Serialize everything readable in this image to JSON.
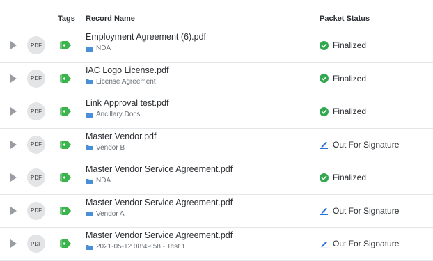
{
  "columns": {
    "tags": "Tags",
    "name": "Record Name",
    "status": "Packet Status"
  },
  "colors": {
    "finalized": "#2fa84f",
    "signature": "#2a72d6",
    "tag": "#3cb44e",
    "folder": "#4a90d9"
  },
  "rows": [
    {
      "file_type": "PDF",
      "name": "Employment Agreement (6).pdf",
      "folder": "NDA",
      "status": "Finalized",
      "status_icon": "check-circle-icon"
    },
    {
      "file_type": "PDF",
      "name": "IAC Logo License.pdf",
      "folder": "License Agreement",
      "status": "Finalized",
      "status_icon": "check-circle-icon"
    },
    {
      "file_type": "PDF",
      "name": "Link Approval test.pdf",
      "folder": "Ancillary Docs",
      "status": "Finalized",
      "status_icon": "check-circle-icon"
    },
    {
      "file_type": "PDF",
      "name": "Master Vendor.pdf",
      "folder": "Vendor B",
      "status": "Out For Signature",
      "status_icon": "pen-icon"
    },
    {
      "file_type": "PDF",
      "name": "Master Vendor Service Agreement.pdf",
      "folder": "NDA",
      "status": "Finalized",
      "status_icon": "check-circle-icon"
    },
    {
      "file_type": "PDF",
      "name": "Master Vendor Service Agreement.pdf",
      "folder": "Vendor A",
      "status": "Out For Signature",
      "status_icon": "pen-icon"
    },
    {
      "file_type": "PDF",
      "name": "Master Vendor Service Agreement.pdf",
      "folder": "2021-05-12 08:49:58 - Test 1",
      "status": "Out For Signature",
      "status_icon": "pen-icon"
    }
  ]
}
